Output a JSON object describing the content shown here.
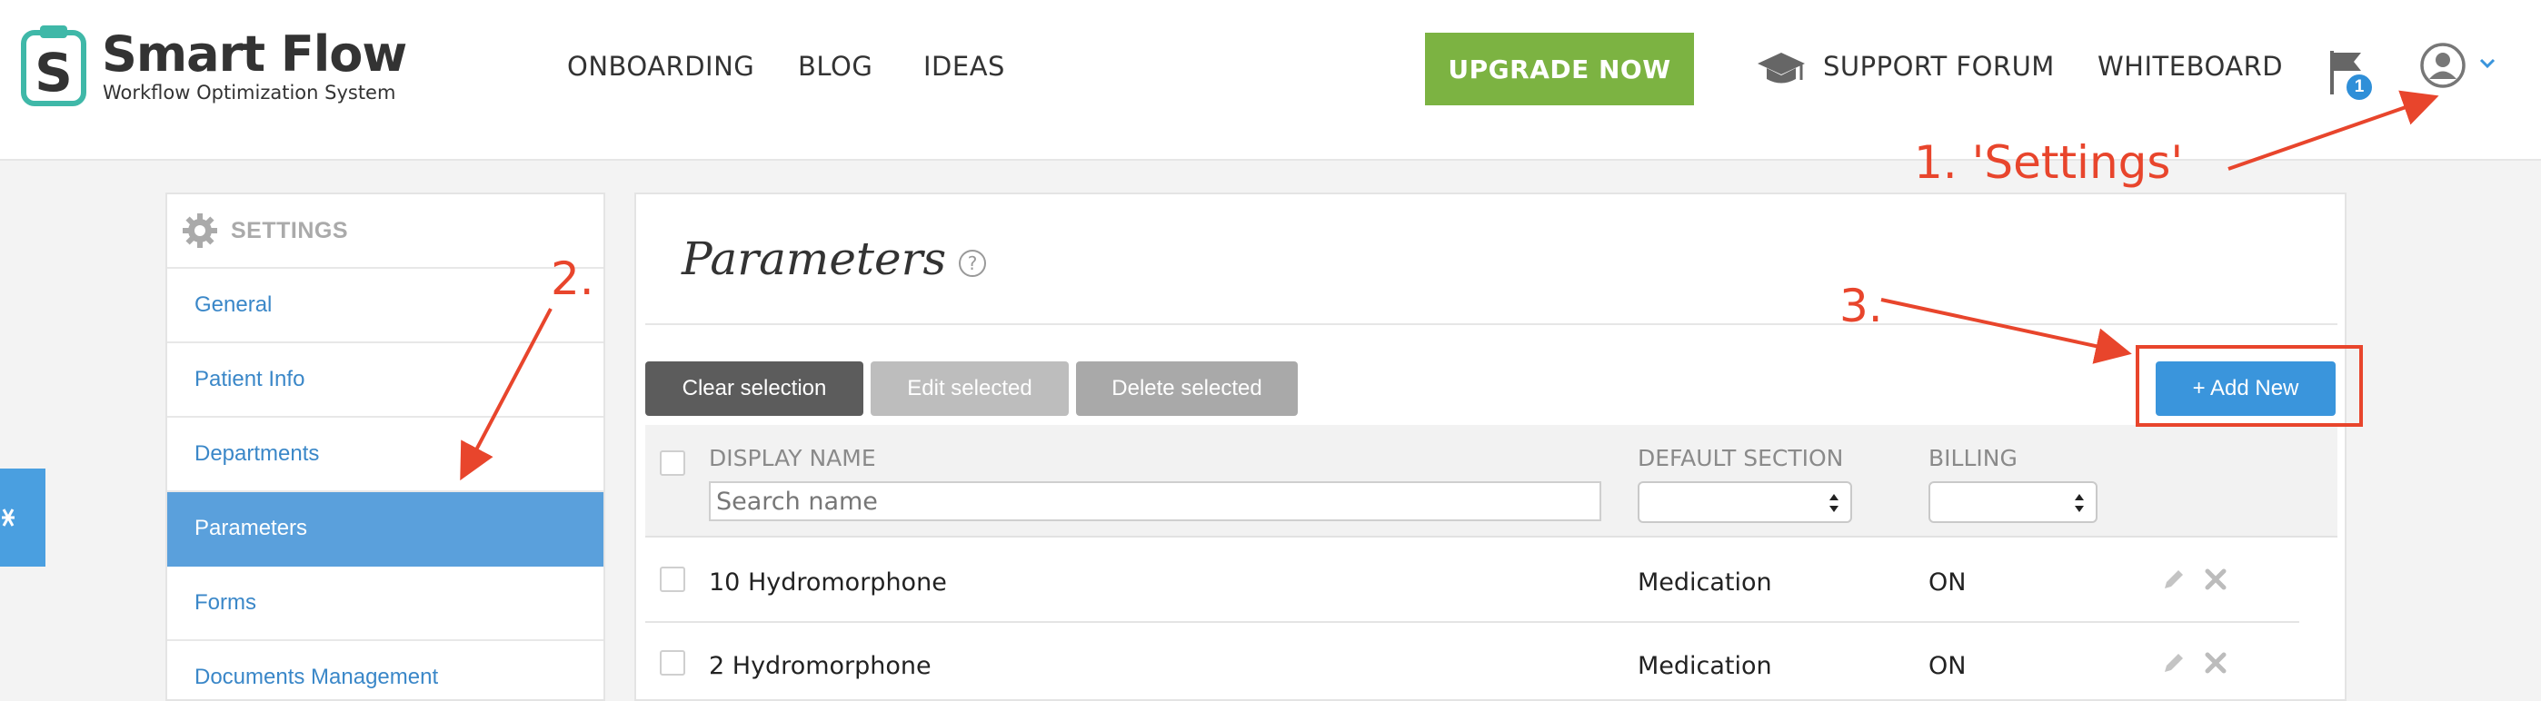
{
  "app": {
    "name": "Smart Flow",
    "tagline": "Workflow Optimization System",
    "logo_letter": "S"
  },
  "nav": {
    "links": [
      "ONBOARDING",
      "BLOG",
      "IDEAS"
    ],
    "upgrade_label": "UPGRADE NOW",
    "support_label": "SUPPORT FORUM",
    "whiteboard_label": "WHITEBOARD",
    "notification_count": "1"
  },
  "sidebar": {
    "heading": "SETTINGS",
    "items": [
      {
        "label": "General"
      },
      {
        "label": "Patient Info"
      },
      {
        "label": "Departments"
      },
      {
        "label": "Parameters",
        "active": true
      },
      {
        "label": "Forms"
      },
      {
        "label": "Documents Management"
      }
    ]
  },
  "main": {
    "title": "Parameters",
    "toolbar": {
      "clear_label": "Clear selection",
      "edit_label": "Edit selected",
      "delete_label": "Delete selected",
      "add_label": "+ Add New"
    },
    "table": {
      "columns": [
        "DISPLAY NAME",
        "DEFAULT SECTION",
        "BILLING"
      ],
      "search_placeholder": "Search name",
      "rows": [
        {
          "name": "10 Hydromorphone",
          "section": "Medication",
          "billing": "ON"
        },
        {
          "name": "2 Hydromorphone",
          "section": "Medication",
          "billing": "ON"
        }
      ]
    }
  },
  "annotations": {
    "step1": "1. 'Settings'",
    "step2": "2.",
    "step3": "3."
  },
  "colors": {
    "brand_teal": "#3fb8a8",
    "upgrade_green": "#7cb342",
    "primary_blue": "#3a95dc",
    "active_blue": "#5aa0dc",
    "link_blue": "#3a87c8",
    "annotation_red": "#e8452c"
  },
  "icons": {
    "logo": "smart-flow-logo-icon",
    "support": "graduation-cap-icon",
    "notifications": "flag-icon",
    "account": "user-circle-icon",
    "settings": "gear-icon",
    "help": "question-circle-icon",
    "edit": "pencil-icon",
    "delete": "close-icon"
  }
}
